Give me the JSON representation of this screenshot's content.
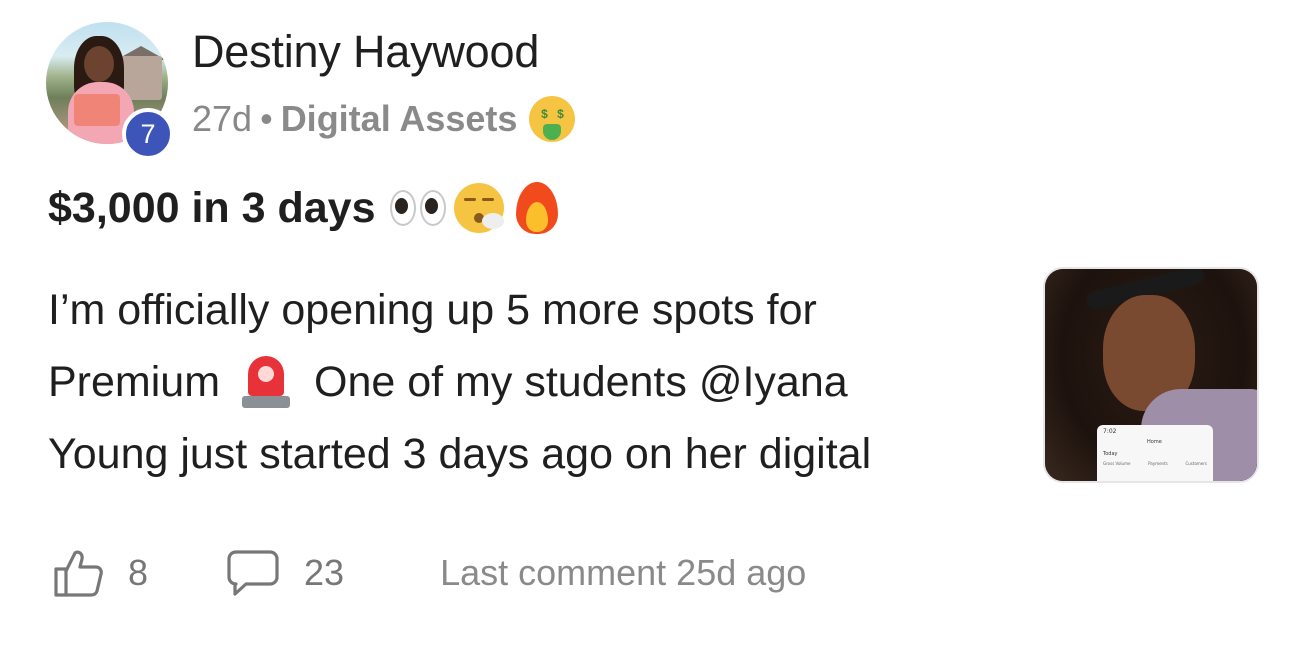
{
  "post": {
    "author": {
      "name": "Destiny Haywood",
      "level": "7"
    },
    "meta": {
      "age": "27d",
      "separator": "•",
      "category": "Digital Assets"
    },
    "title": "$3,000 in 3 days",
    "body": {
      "line1": "I’m officially opening up 5 more spots for",
      "line2_before": "Premium",
      "line2_after": "One of my students @Iyana",
      "line3": "Young just started 3 days ago on her digital"
    },
    "thumbnail": {
      "phone_time": "7:02",
      "phone_home": "Home",
      "phone_today": "Today",
      "phone_columns": [
        "Gross Volume",
        "Payments",
        "Customers"
      ]
    },
    "actions": {
      "likes": "8",
      "comments": "23",
      "last_comment": "Last comment 25d ago"
    }
  },
  "icons": {
    "category_emoji": "money-mouth-face-icon",
    "title_emojis": [
      "eyes-icon",
      "exhaling-face-icon",
      "fire-icon"
    ],
    "body_emoji": "police-light-icon",
    "like": "thumbs-up-icon",
    "comment": "comment-bubble-icon"
  },
  "colors": {
    "badge": "#3d55b8",
    "text": "#1f1f1f",
    "muted": "#888888"
  }
}
